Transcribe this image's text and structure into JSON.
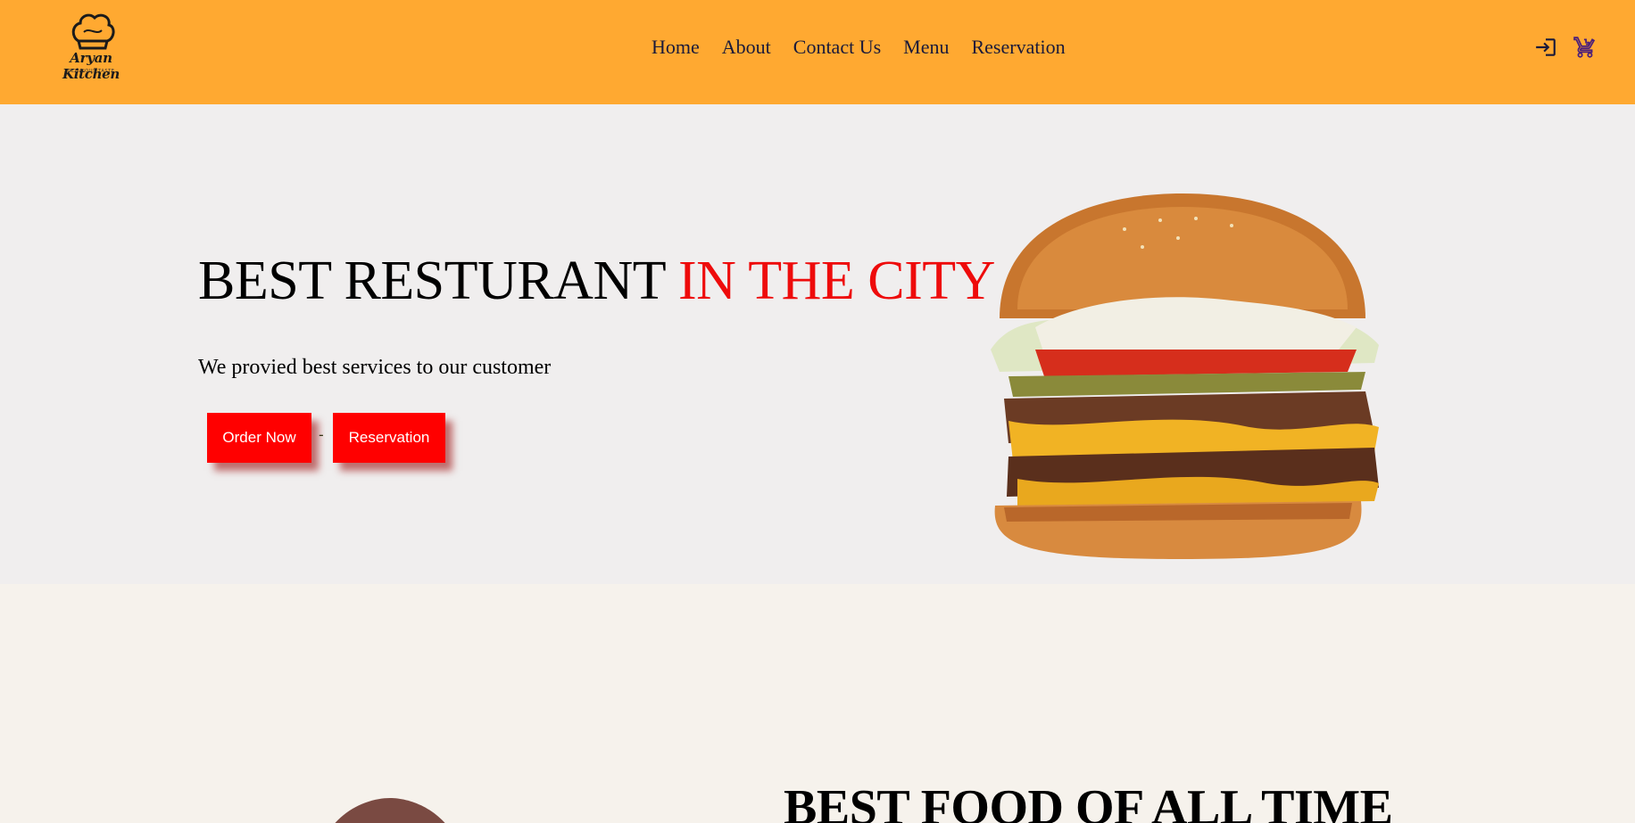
{
  "brand": {
    "name": "Aryan Kitchen",
    "tagline": "DELICIOUS TASTE"
  },
  "nav": {
    "items": [
      "Home",
      "About",
      "Contact Us",
      "Menu",
      "Reservation"
    ]
  },
  "header_icons": [
    "login-icon",
    "cart-icon"
  ],
  "hero": {
    "title_part1": "BEST RESTURANT ",
    "title_part2": "IN THE CITY",
    "subtitle": "We provied best services to our customer",
    "order_button": "Order Now",
    "separator": "-",
    "reservation_button": "Reservation"
  },
  "section2": {
    "title": "BEST FOOD OF ALL TIME"
  },
  "colors": {
    "header_bg": "#ffa931",
    "hero_bg": "#f0eeee",
    "accent_red": "#ee0b0b",
    "button_red": "#ff0000",
    "icon_color": "#4b1f7a"
  }
}
